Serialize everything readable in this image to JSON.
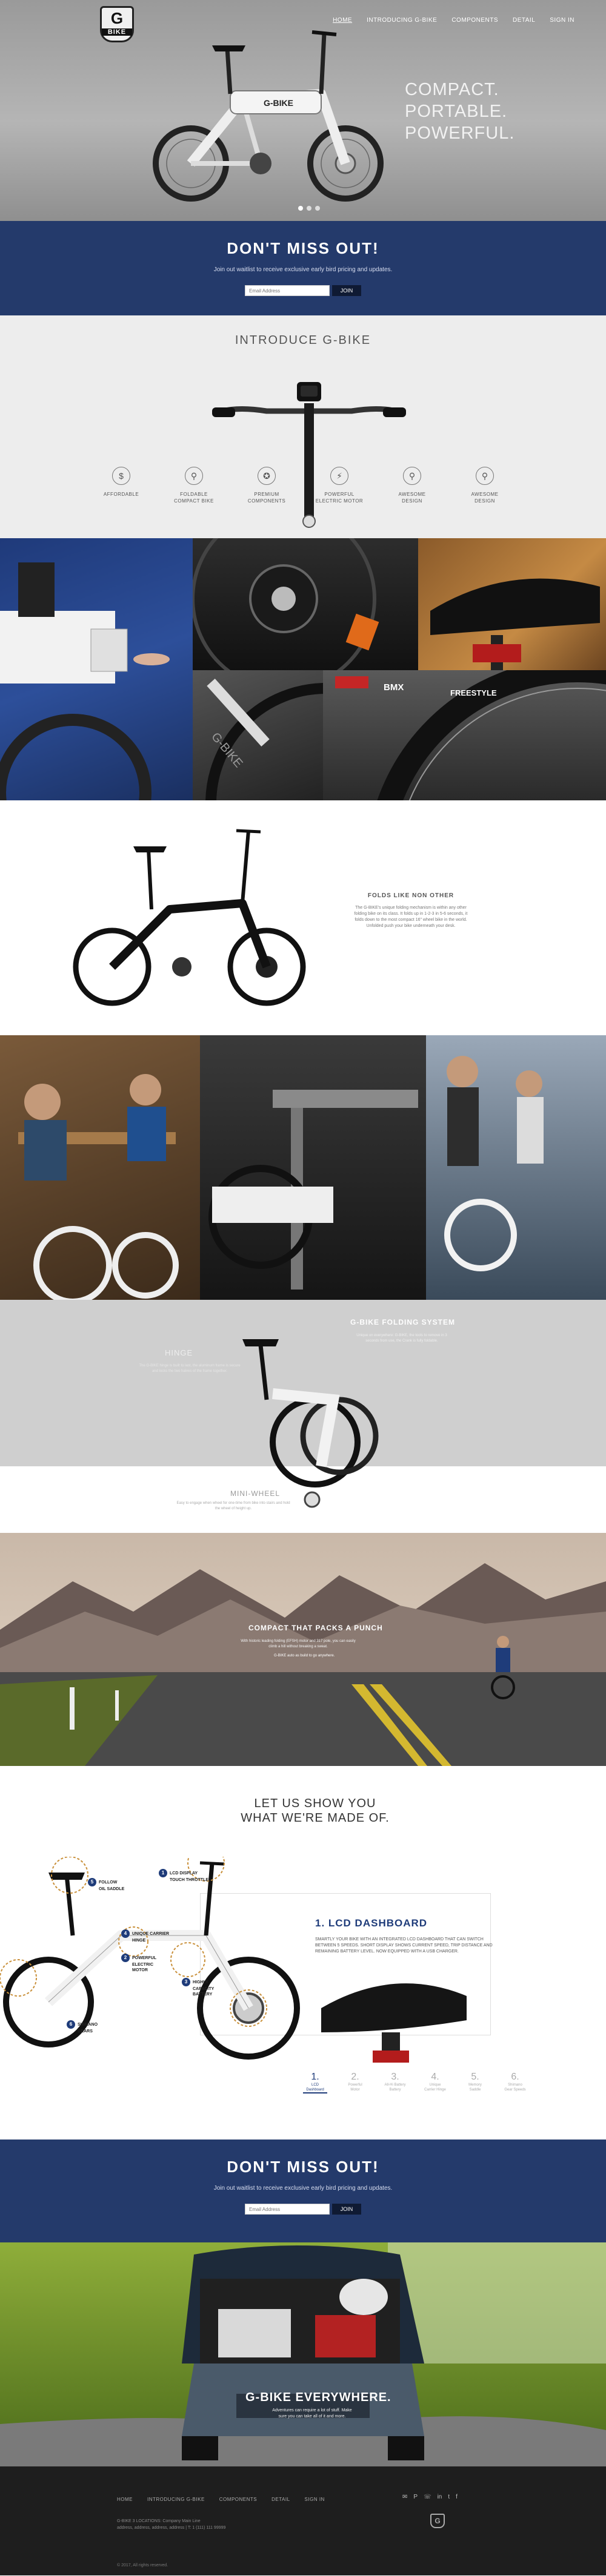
{
  "header": {
    "logo_letter": "G",
    "logo_word": "BIKE",
    "nav": [
      "HOME",
      "INTRODUCING G-BIKE",
      "COMPONENTS",
      "DETAIL",
      "SIGN IN"
    ]
  },
  "hero": {
    "tagline": [
      "COMPACT.",
      "PORTABLE.",
      "POWERFUL."
    ],
    "bike_brand": "G-BIKE"
  },
  "newsletter": {
    "title": "DON'T MISS OUT!",
    "text": "Join out waitlist to receive exclusive early bird pricing and updates.",
    "placeholder": "Email Address",
    "button": "JOIN"
  },
  "intro": {
    "title": "INTRODUCE G-BIKE",
    "features": [
      {
        "icon": "dollar-icon",
        "glyph": "$",
        "label": [
          "AFFORDABLE"
        ]
      },
      {
        "icon": "bike-icon",
        "glyph": "⚲",
        "label": [
          "FOLDABLE",
          "COMPACT BIKE"
        ]
      },
      {
        "icon": "award-icon",
        "glyph": "✪",
        "label": [
          "PREMIUM",
          "COMPONENTS"
        ]
      },
      {
        "icon": "lightning-icon",
        "glyph": "⚡",
        "label": [
          "POWERFUL",
          "ELECTRIC MOTOR"
        ]
      },
      {
        "icon": "bike-icon",
        "glyph": "⚲",
        "label": [
          "AWESOME",
          "DESIGN"
        ]
      },
      {
        "icon": "bike-icon",
        "glyph": "⚲",
        "label": [
          "AWESOME",
          "DESIGN"
        ]
      }
    ]
  },
  "grid1": {
    "tire_brand": "BMX",
    "tire_text": "FREESTYLE"
  },
  "folds": {
    "title": "FOLDS LIKE NON OTHER",
    "text": "The G-BIKE's unique folding mechanism is within any other folding bike on its class. It folds up in 1-2-3 in 5-6 seconds, it folds down to the most compact 16\" wheel bike in the world. Unfolded push your bike underneath your desk."
  },
  "folding_system": {
    "title": "G-BIKE FOLDING SYSTEM",
    "text": "Unique on everywhere: G-BIKE, the tools to remove in 3 seconds from use, the Crank is fully foldable.",
    "hinge_title": "HINGE",
    "hinge_text": "The G-BIKE hinge is built to last, the aluminum frame is secure and locks the two halves of the frame together.",
    "mini_title": "MINI-WHEEL",
    "mini_text": "Easy to engage when wheel for one-time from bike into stairs and hold the wheel of height up."
  },
  "punch": {
    "title": "COMPACT THAT PACKS A PUNCH",
    "text": "With historic leading folding (EFSH) motor and 317 pole, you can easily climb a hill without breaking a sweat.",
    "extra": "G-BIKE auto as build to go anywhere."
  },
  "madeof": {
    "title": [
      "LET US SHOW YOU",
      "WHAT WE'RE MADE OF."
    ],
    "callouts": [
      {
        "n": "5",
        "text": [
          "FOLLOW",
          "OIL SADDLE"
        ]
      },
      {
        "n": "1",
        "text": [
          "LCD DISPLAY",
          "TOUCH THROTTLE"
        ]
      },
      {
        "n": "4",
        "text": [
          "UNIQUE CARRIER",
          "HINGE"
        ]
      },
      {
        "n": "2",
        "text": [
          "POWERFUL",
          "ELECTRIC",
          "MOTOR"
        ]
      },
      {
        "n": "6",
        "text": [
          "SHIMANO",
          "GEARS"
        ]
      },
      {
        "n": "3",
        "text": [
          "HIGHLY",
          "CAPACITY",
          "BATTERY"
        ]
      }
    ],
    "spec_title": "1. LCD DASHBOARD",
    "spec_text": "SMARTLY YOUR BIKE WITH AN INTEGRATED LCD DASHBOARD THAT CAN SWITCH BETWEEN 5 SPEEDS. SHORT DISPLAY SHOWS CURRENT SPEED, TRIP DISTANCE AND REMAINING BATTERY LEVEL. NOW EQUIPPED WITH A USB CHARGER.",
    "steps": [
      {
        "n": "1.",
        "t": [
          "LCD",
          "Dashboard"
        ]
      },
      {
        "n": "2.",
        "t": [
          "Powerful",
          "Motor"
        ]
      },
      {
        "n": "3.",
        "t": [
          "All-Hi Battery",
          "Battery"
        ]
      },
      {
        "n": "4.",
        "t": [
          "Unique",
          "Carrier Hinge"
        ]
      },
      {
        "n": "5.",
        "t": [
          "Memory",
          "Saddle"
        ]
      },
      {
        "n": "6.",
        "t": [
          "Shimano",
          "Gear Speeds"
        ]
      }
    ]
  },
  "newsletter2": {
    "title": "DON'T MISS OUT!",
    "text": "Join out waitlist to receive exclusive early bird pricing and updates.",
    "placeholder": "Email Address",
    "button": "JOIN"
  },
  "car": {
    "title": "G-BIKE EVERYWHERE.",
    "text": "Adventures can require a lot of stuff. Make sure you can take all of it and more."
  },
  "footer": {
    "nav": [
      "HOME",
      "INTRODUCING G-BIKE",
      "COMPONENTS",
      "DETAIL",
      "SIGN IN"
    ],
    "address": [
      "G-BIKE 3 LOCATIONS: Company Main Line",
      "address, address, address, address  |  T: 1 (111) 111 99999"
    ],
    "social": [
      "✉",
      "P",
      "☏",
      "in",
      "t",
      "f"
    ],
    "social_icons": [
      "email-icon",
      "pinterest-icon",
      "phone-icon",
      "linkedin-icon",
      "twitter-icon",
      "facebook-icon"
    ],
    "logo_letter": "G",
    "copyright": "© 2017, All rights reserved."
  }
}
